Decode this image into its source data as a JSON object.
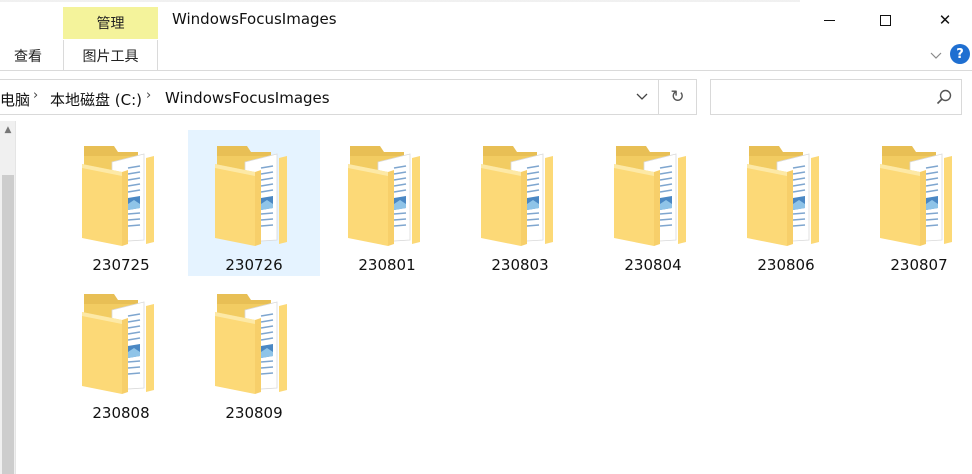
{
  "window": {
    "title": "WindowsFocusImages",
    "context_tab_header": "管理",
    "minimize_label": "",
    "maximize_label": "",
    "close_label": "✕"
  },
  "ribbon": {
    "tabs": [
      {
        "label": "查看"
      },
      {
        "label": "图片工具"
      }
    ],
    "expand_icon": "chevron-down-icon",
    "help_label": "?"
  },
  "address": {
    "breadcrumbs": [
      "电脑",
      "本地磁盘 (C:)",
      "WindowsFocusImages"
    ],
    "separator": "›",
    "dropdown_glyph": "⌄",
    "refresh_glyph": "↻"
  },
  "search": {
    "placeholder": "",
    "icon": "search-icon"
  },
  "colors": {
    "context_tab": "#f4f39b",
    "selection": "#e5f3ff",
    "folder_back": "#e8bf55",
    "folder_front": "#fcd977",
    "help": "#1f6fd1"
  },
  "folders": [
    {
      "name": "230725",
      "selected": false
    },
    {
      "name": "230726",
      "selected": true
    },
    {
      "name": "230801",
      "selected": false
    },
    {
      "name": "230803",
      "selected": false
    },
    {
      "name": "230804",
      "selected": false
    },
    {
      "name": "230806",
      "selected": false
    },
    {
      "name": "230807",
      "selected": false
    },
    {
      "name": "230808",
      "selected": false
    },
    {
      "name": "230809",
      "selected": false
    }
  ]
}
